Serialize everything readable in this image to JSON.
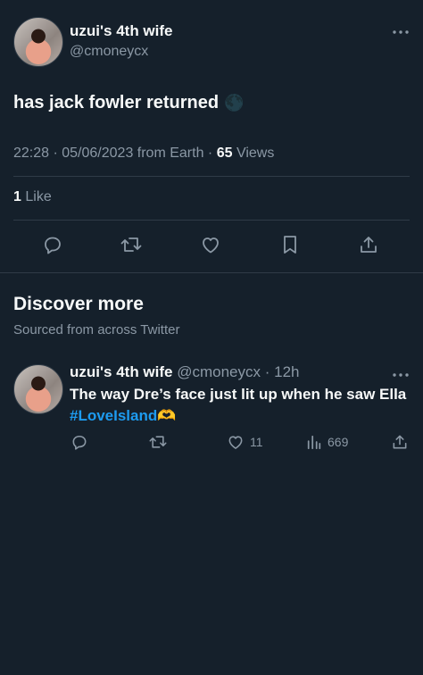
{
  "tweet": {
    "display_name": "uzui's 4th wife",
    "handle": "@cmoneycx",
    "text": "has jack fowler returned",
    "emoji": "🌑",
    "timestamp": "22:28 · 05/06/2023 from Earth · ",
    "views_count": "65",
    "views_label": "Views",
    "likes_count": "1",
    "likes_label": "Like"
  },
  "discover": {
    "title": "Discover more",
    "subtitle": "Sourced from across Twitter"
  },
  "related_tweet": {
    "display_name": "uzui's 4th wife",
    "handle": "@cmoneycx",
    "time": "· 12h",
    "text_prefix": "The way Dre’s face just lit up when he saw Ella ",
    "hashtag": "#LoveIsland",
    "emoji": "🫶",
    "like_count": "11",
    "view_count": "669"
  },
  "colors": {
    "background": "#15202b",
    "muted": "#8b98a5",
    "accent": "#1d9bf0"
  }
}
